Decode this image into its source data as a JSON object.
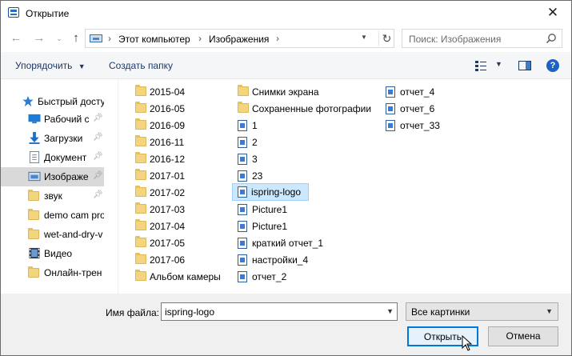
{
  "window": {
    "title": "Открытие"
  },
  "nav": {
    "breadcrumb": [
      "Этот компьютер",
      "Изображения"
    ],
    "search_placeholder": "Поиск: Изображения"
  },
  "toolbar": {
    "organize": "Упорядочить",
    "new_folder": "Создать папку"
  },
  "sidebar": {
    "items": [
      {
        "label": "Быстрый досту",
        "icon": "star-icon",
        "pinned": false,
        "selected": false
      },
      {
        "label": "Рабочий с",
        "icon": "desktop-icon",
        "pinned": true,
        "selected": false
      },
      {
        "label": "Загрузки",
        "icon": "download-icon",
        "pinned": true,
        "selected": false
      },
      {
        "label": "Документ",
        "icon": "document-icon",
        "pinned": true,
        "selected": false
      },
      {
        "label": "Изображе",
        "icon": "pictures-icon",
        "pinned": true,
        "selected": true
      },
      {
        "label": "звук",
        "icon": "folder-icon",
        "pinned": true,
        "selected": false
      },
      {
        "label": "demo cam pro",
        "icon": "folder-icon",
        "pinned": false,
        "selected": false
      },
      {
        "label": "wet-and-dry-v",
        "icon": "folder-icon",
        "pinned": false,
        "selected": false
      },
      {
        "label": "Видео",
        "icon": "video-icon",
        "pinned": false,
        "selected": false
      },
      {
        "label": "Онлайн-трен",
        "icon": "folder-icon",
        "pinned": false,
        "selected": false
      }
    ]
  },
  "files": {
    "col1": [
      "2015-04",
      "2016-05",
      "2016-09",
      "2016-11",
      "2016-12",
      "2017-01",
      "2017-02",
      "2017-03",
      "2017-04",
      "2017-05",
      "2017-06",
      "Альбом камеры"
    ],
    "col2": [
      {
        "name": "Снимки экрана",
        "type": "folder"
      },
      {
        "name": "Сохраненные фотографии",
        "type": "folder"
      },
      {
        "name": "1",
        "type": "image"
      },
      {
        "name": "2",
        "type": "image"
      },
      {
        "name": "3",
        "type": "image"
      },
      {
        "name": "23",
        "type": "image"
      },
      {
        "name": "ispring-logo",
        "type": "image"
      },
      {
        "name": "Picture1",
        "type": "image"
      },
      {
        "name": "Picture1",
        "type": "image"
      },
      {
        "name": "краткий отчет_1",
        "type": "image"
      },
      {
        "name": "настройки_4",
        "type": "image"
      },
      {
        "name": "отчет_2",
        "type": "image"
      }
    ],
    "col3": [
      "отчет_4",
      "отчет_6",
      "отчет_33"
    ],
    "selected": "ispring-logo"
  },
  "footer": {
    "filename_label": "Имя файла:",
    "filename_value": "ispring-logo",
    "filter_value": "Все картинки",
    "open_button": "Открыть",
    "cancel_button": "Отмена"
  },
  "colors": {
    "accent": "#0078d7",
    "selection": "#cce8ff",
    "folder": "#f2d57e"
  }
}
